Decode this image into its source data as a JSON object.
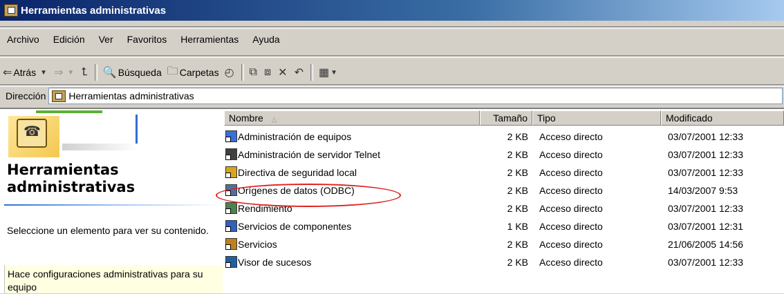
{
  "window": {
    "title": "Herramientas administrativas"
  },
  "menu": [
    "Archivo",
    "Edición",
    "Ver",
    "Favoritos",
    "Herramientas",
    "Ayuda"
  ],
  "toolbar": {
    "back_label": "Atrás",
    "search_label": "Búsqueda",
    "folders_label": "Carpetas"
  },
  "address": {
    "label": "Dirección",
    "value": "Herramientas administrativas"
  },
  "left_panel": {
    "title_line1": "Herramientas",
    "title_line2": "administrativas",
    "prompt": "Seleccione un elemento para ver su contenido.",
    "info": "Hace configuraciones administrativas para su equipo"
  },
  "columns": {
    "name": "Nombre",
    "size": "Tamaño",
    "type": "Tipo",
    "modified": "Modificado"
  },
  "files": [
    {
      "name": "Administración de equipos",
      "size": "2 KB",
      "type": "Acceso directo",
      "modified": "03/07/2001 12:33",
      "icon": "computer-management-icon",
      "color": "#3a6fd8"
    },
    {
      "name": "Administración de servidor Telnet",
      "size": "2 KB",
      "type": "Acceso directo",
      "modified": "03/07/2001 12:33",
      "icon": "telnet-icon",
      "color": "#404040"
    },
    {
      "name": "Directiva de seguridad local",
      "size": "2 KB",
      "type": "Acceso directo",
      "modified": "03/07/2001 12:33",
      "icon": "security-policy-icon",
      "color": "#d9a520"
    },
    {
      "name": "Orígenes de datos (ODBC)",
      "size": "2 KB",
      "type": "Acceso directo",
      "modified": "14/03/2007 9:53",
      "icon": "odbc-icon",
      "color": "#5070a0"
    },
    {
      "name": "Rendimiento",
      "size": "2 KB",
      "type": "Acceso directo",
      "modified": "03/07/2001 12:33",
      "icon": "performance-icon",
      "color": "#508050"
    },
    {
      "name": "Servicios de componentes",
      "size": "1 KB",
      "type": "Acceso directo",
      "modified": "03/07/2001 12:31",
      "icon": "component-services-icon",
      "color": "#3060c0"
    },
    {
      "name": "Servicios",
      "size": "2 KB",
      "type": "Acceso directo",
      "modified": "21/06/2005 14:56",
      "icon": "services-icon",
      "color": "#c08020"
    },
    {
      "name": "Visor de sucesos",
      "size": "2 KB",
      "type": "Acceso directo",
      "modified": "03/07/2001 12:33",
      "icon": "event-viewer-icon",
      "color": "#2060a0"
    }
  ],
  "highlight_color": "#e0201e"
}
